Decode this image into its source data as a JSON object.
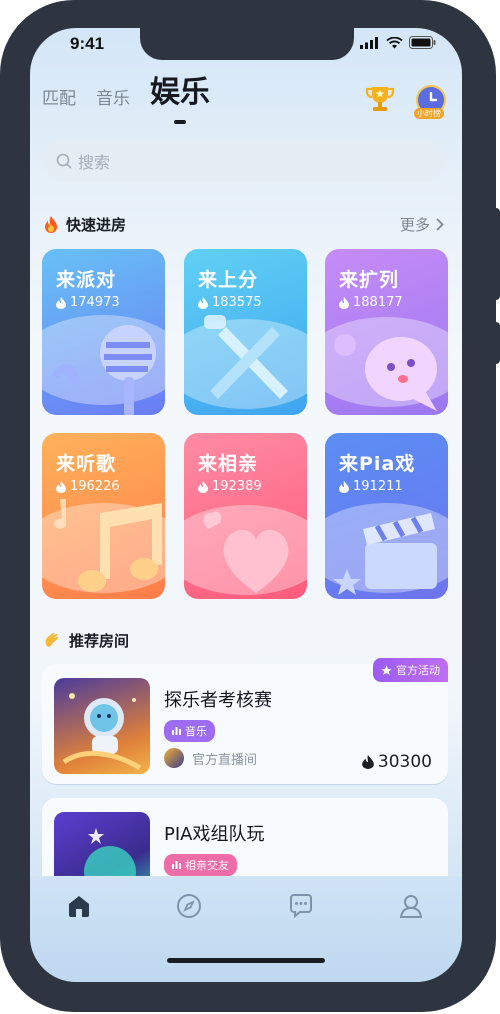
{
  "status": {
    "time": "9:41"
  },
  "tabs": [
    {
      "label": "匹配",
      "active": false
    },
    {
      "label": "音乐",
      "active": false
    },
    {
      "label": "娱乐",
      "active": true
    }
  ],
  "header": {
    "trophy_icon": "trophy-icon",
    "rank_label": "小时榜"
  },
  "search": {
    "placeholder": "搜索"
  },
  "quick_rooms": {
    "title": "快速进房",
    "more_label": "更多",
    "cards": [
      {
        "title": "来派对",
        "count": "174973",
        "color_top": "#67c1f6",
        "color_bottom": "#6a7cf3",
        "icon": "microphone-icon"
      },
      {
        "title": "来上分",
        "count": "183575",
        "color_top": "#60d1f4",
        "color_bottom": "#3fa4f0",
        "icon": "crossed-swords-icon"
      },
      {
        "title": "来扩列",
        "count": "188177",
        "color_top": "#c68cf7",
        "color_bottom": "#9b77f1",
        "icon": "chat-bubble-icon"
      },
      {
        "title": "来听歌",
        "count": "196226",
        "color_top": "#ffb25a",
        "color_bottom": "#ff7c4a",
        "icon": "music-note-icon"
      },
      {
        "title": "来相亲",
        "count": "192389",
        "color_top": "#ff8ca4",
        "color_bottom": "#fd5a7b",
        "icon": "heart-icon"
      },
      {
        "title": "来Pia戏",
        "count": "191211",
        "color_top": "#5a8ef4",
        "color_bottom": "#6e74ee",
        "icon": "clapperboard-icon"
      }
    ]
  },
  "recommended": {
    "title": "推荐房间",
    "rooms": [
      {
        "name": "探乐者考核赛",
        "tag": "音乐",
        "tag_color": "#9d6cf1",
        "badge": "官方活动",
        "host": "官方直播间",
        "heat": "30300"
      },
      {
        "name": "PIA戏组队玩",
        "tag": "相亲交友",
        "tag_color": "#ee6ca8"
      }
    ]
  },
  "bottom_nav": [
    {
      "icon": "home-icon",
      "active": true
    },
    {
      "icon": "compass-icon",
      "active": false
    },
    {
      "icon": "message-icon",
      "active": false
    },
    {
      "icon": "profile-icon",
      "active": false
    }
  ]
}
